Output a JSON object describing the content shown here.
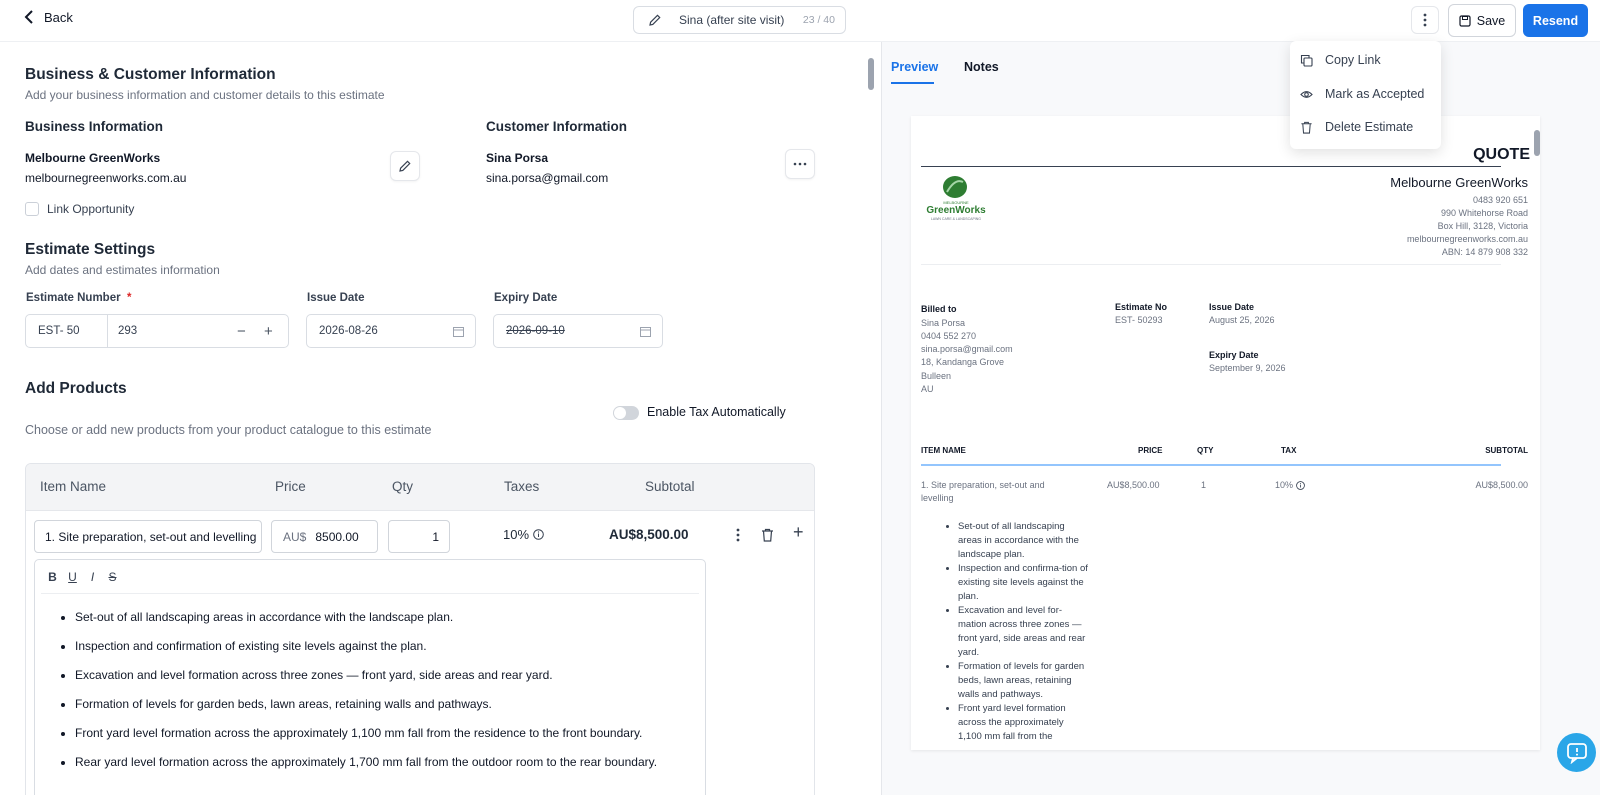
{
  "topbar": {
    "back_label": "Back",
    "estimate_title": "Sina (after site visit)",
    "title_count": "23 / 40",
    "save_label": "Save",
    "resend_label": "Resend"
  },
  "menu": {
    "items": [
      {
        "label": "Copy Link",
        "icon": "copy-icon"
      },
      {
        "label": "Mark as Accepted",
        "icon": "eye-icon"
      },
      {
        "label": "Delete Estimate",
        "icon": "trash-icon"
      }
    ]
  },
  "business_section": {
    "title": "Business & Customer Information",
    "subtitle": "Add your business information and customer details to this estimate",
    "business_heading": "Business Information",
    "business_name": "Melbourne GreenWorks",
    "business_site": "melbournegreenworks.com.au",
    "customer_heading": "Customer Information",
    "customer_name": "Sina Porsa",
    "customer_email": "sina.porsa@gmail.com",
    "link_opportunity": "Link Opportunity"
  },
  "settings": {
    "title": "Estimate Settings",
    "subtitle": "Add dates and estimates information",
    "estimate_number_label": "Estimate Number",
    "required_mark": "*",
    "prefix": "EST- 50",
    "number": "293",
    "issue_date_label": "Issue Date",
    "issue_date": "2026-08-26",
    "expiry_date_label": "Expiry Date",
    "expiry_date": "2026-09-10"
  },
  "products": {
    "title": "Add Products",
    "tax_toggle_label": "Enable Tax Automatically",
    "subtitle": "Choose or add new products from your product catalogue to this estimate",
    "columns": [
      "Item Name",
      "Price",
      "Qty",
      "Taxes",
      "Subtotal"
    ],
    "row": {
      "item_name": "1. Site preparation, set-out and levelling",
      "currency": "AU$",
      "price": "8500.00",
      "qty": "1",
      "tax": "10%",
      "subtotal": "AU$8,500.00"
    },
    "editor_tools": [
      "B",
      "U",
      "I",
      "S"
    ],
    "description": [
      "Set-out of all landscaping areas in accordance with the landscape plan.",
      "Inspection and confirmation of existing site levels against the plan.",
      "Excavation and level formation across three zones — front yard, side areas and rear yard.",
      "Formation of levels for garden beds, lawn areas, retaining walls and pathways.",
      "Front yard level formation across the approximately 1,100 mm fall from the residence to the front boundary.",
      "Rear yard level formation across the approximately 1,700 mm fall from the outdoor room to the rear boundary."
    ]
  },
  "preview": {
    "tabs": [
      "Preview",
      "Notes"
    ],
    "doc_title": "QUOTE",
    "logo_small": "MELBOURNE",
    "logo_big": "GreenWorks",
    "logo_tag": "LAWN CARE & LANDSCAPING",
    "company": "Melbourne GreenWorks",
    "phone": "0483 920 651",
    "street": "990 Whitehorse Road",
    "suburb": "Box Hill, 3128, Victoria",
    "site": "melbournegreenworks.com.au",
    "abn": "ABN: 14 879 908 332",
    "billed_to_label": "Billed to",
    "billed_lines": [
      "Sina Porsa",
      "0404 552 270",
      "sina.porsa@gmail.com",
      "18, Kandanga Grove",
      "Bulleen",
      "AU"
    ],
    "estimate_no_label": "Estimate No",
    "estimate_no": "EST- 50293",
    "issue_label": "Issue Date",
    "issue_value": "August 25, 2026",
    "expiry_label": "Expiry Date",
    "expiry_value": "September 9, 2026",
    "columns": [
      "ITEM NAME",
      "PRICE",
      "QTY",
      "TAX",
      "SUBTOTAL"
    ],
    "item_line1": "1. Site preparation, set-out and",
    "item_line2": "levelling",
    "item_price": "AU$8,500.00",
    "item_qty": "1",
    "item_tax": "10%",
    "item_subtotal": "AU$8,500.00",
    "bullets": [
      "Set-out of all landscaping areas in accordance with the landscape plan.",
      "Inspection and confirma-tion of existing site levels against the plan.",
      "Excavation and level for-mation across three zones — front yard, side areas and rear yard.",
      "Formation of levels for garden beds, lawn areas, retaining walls and pathways.",
      "Front yard level formation across the approximately 1,100 mm fall from the"
    ]
  },
  "colors": {
    "accent": "#1a73e8",
    "help": "#2aa6e8",
    "logo_green": "#2e7d32"
  }
}
